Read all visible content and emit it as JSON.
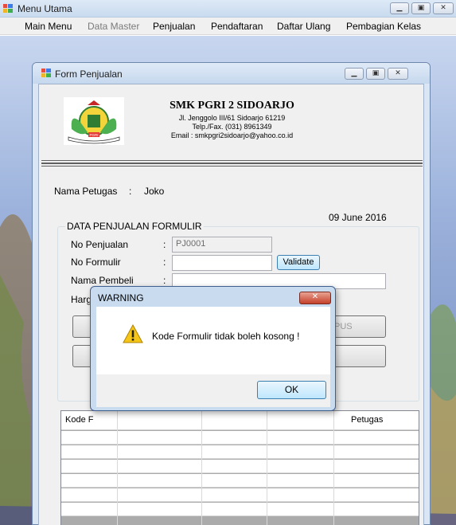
{
  "main_window": {
    "title": "Menu Utama",
    "menu": [
      "Main Menu",
      "Data Master",
      "Penjualan",
      "Pendaftaran",
      "Daftar Ulang",
      "Pembagian Kelas"
    ]
  },
  "form": {
    "title": "Form Penjualan",
    "school": {
      "name": "SMK PGRI 2 SIDOARJO",
      "address": "Jl. Jenggolo III/61 Sidoarjo 61219",
      "phone": "Telp./Fax. (031) 8961349",
      "email": "Email : smkpgri2sidoarjo@yahoo.co.id",
      "logo_text": "PGRI"
    },
    "petugas_label": "Nama Petugas",
    "petugas_sep": ":",
    "petugas_value": "Joko",
    "date": "09 June 2016",
    "group_title": "DATA PENJUALAN FORMULIR",
    "fields": {
      "no_penjualan_label": "No Penjualan",
      "no_penjualan_value": "PJ0001",
      "no_formulir_label": "No Formulir",
      "no_formulir_value": "",
      "nama_pembeli_label": "Nama Pembeli",
      "nama_pembeli_value": "",
      "harga_label": "Harg",
      "sep": ":"
    },
    "validate_label": "Validate",
    "hapus_label_partial": "PUS",
    "grid": {
      "col_kode_partial": "Kode F",
      "col_petugas": "Petugas"
    }
  },
  "dialog": {
    "title": "WARNING",
    "message": "Kode Formulir tidak boleh kosong !",
    "ok_label": "OK"
  },
  "colors": {
    "mdi_bg": "#9db3dc",
    "dialog_frame": "#c9dbef",
    "close_red": "#c4412b"
  }
}
